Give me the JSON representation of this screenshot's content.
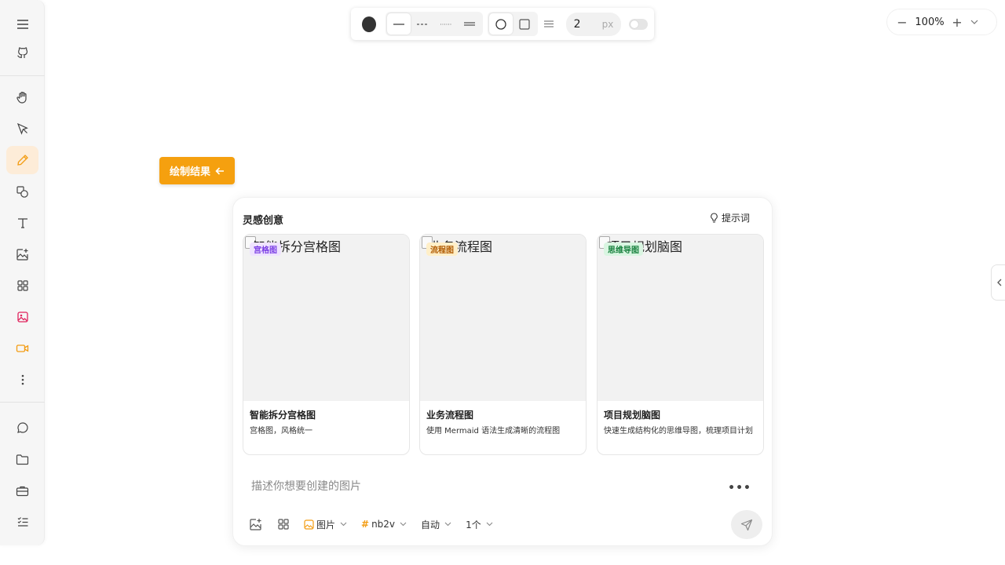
{
  "toolbar": {
    "stroke_color": "#333333",
    "stroke_width_value": "2",
    "stroke_width_unit": "px"
  },
  "zoom": {
    "minus_label": "−",
    "value": "100%",
    "plus_label": "+"
  },
  "draw_result_button": {
    "label": "绘制结果"
  },
  "panel": {
    "title": "灵感创意",
    "hint_label": "提示词",
    "cards": [
      {
        "alt_text": "智能拆分宫格图",
        "tag": "宫格图",
        "tag_color": "#7b3fe4",
        "tag_bg": "#efe3ff",
        "name": "智能拆分宫格图",
        "description": "宫格图，风格统一"
      },
      {
        "alt_text": "业务流程图",
        "tag": "流程图",
        "tag_color": "#b05a00",
        "tag_bg": "#ffefc8",
        "name": "业务流程图",
        "description": "使用 Mermaid 语法生成清晰的流程图"
      },
      {
        "alt_text": "项目规划脑图",
        "tag": "思维导图",
        "tag_color": "#17803d",
        "tag_bg": "#d9f5e1",
        "name": "项目规划脑图",
        "description": "快速生成结构化的思维导图，梳理项目计划"
      }
    ],
    "prompt_placeholder": "描述你想要创建的图片",
    "more_label": "•••",
    "bottom": {
      "type_label": "图片",
      "model_hash": "#",
      "model_label": "nb2v",
      "ratio_label": "自动",
      "count_label": "1个"
    }
  },
  "colors": {
    "accent": "#f5a00f",
    "active_tool_bg": "#fdecd8"
  }
}
